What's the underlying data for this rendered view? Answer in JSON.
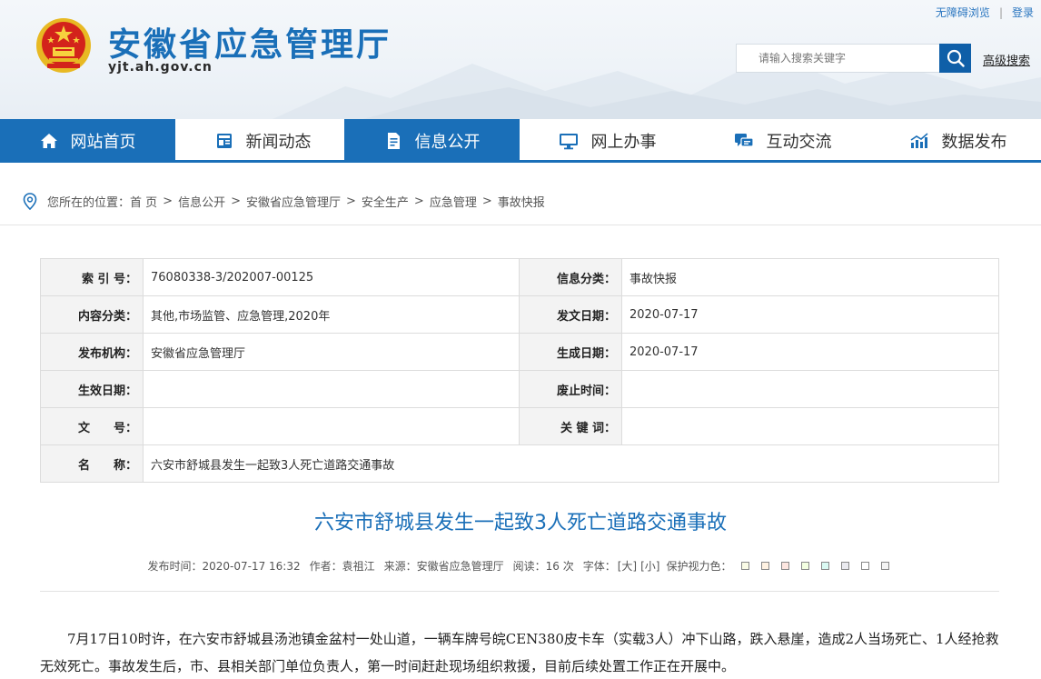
{
  "header": {
    "site_title": "安徽省应急管理厅",
    "domain": "yjt.ah.gov.cn",
    "top_links": {
      "accessibility": "无障碍浏览",
      "login": "登录"
    },
    "search": {
      "placeholder": "请输入搜索关键字",
      "advanced": "高级搜索"
    }
  },
  "nav": {
    "items": [
      {
        "label": "网站首页",
        "icon": "home-icon",
        "active": true
      },
      {
        "label": "新闻动态",
        "icon": "news-icon",
        "active": false
      },
      {
        "label": "信息公开",
        "icon": "document-icon",
        "active": true
      },
      {
        "label": "网上办事",
        "icon": "monitor-icon",
        "active": false
      },
      {
        "label": "互动交流",
        "icon": "chat-icon",
        "active": false
      },
      {
        "label": "数据发布",
        "icon": "chart-icon",
        "active": false
      }
    ]
  },
  "breadcrumb": {
    "prefix": "您所在的位置：",
    "items": [
      "首 页",
      "信息公开",
      "安徽省应急管理厅",
      "安全生产",
      "应急管理",
      "事故快报"
    ],
    "separator": ">"
  },
  "meta": {
    "index_label": "索 引 号：",
    "index_value": "76080338-3/202007-00125",
    "category_label": "信息分类：",
    "category_value": "事故快报",
    "content_label": "内容分类：",
    "content_value": "其他,市场监管、应急管理,2020年",
    "issue_date_label": "发文日期：",
    "issue_date_value": "2020-07-17",
    "org_label": "发布机构：",
    "org_value": "安徽省应急管理厅",
    "gen_date_label": "生成日期：",
    "gen_date_value": "2020-07-17",
    "effective_label": "生效日期：",
    "effective_value": "",
    "abolish_label": "废止时间：",
    "abolish_value": "",
    "docno_label": "文　　号：",
    "docno_value": "",
    "keywords_label": "关 键 词：",
    "keywords_value": "",
    "name_label": "名　　称：",
    "name_value": "六安市舒城县发生一起致3人死亡道路交通事故"
  },
  "article": {
    "title": "六安市舒城县发生一起致3人死亡道路交通事故",
    "publish_time": "发布时间：2020-07-17 16:32",
    "author": "作者：袁祖江",
    "source": "来源：安徽省应急管理厅",
    "views": "阅读：16 次",
    "font_label": "字体：",
    "font_large": "[大]",
    "font_small": "[小]",
    "eye_label": "保护视力色：",
    "eye_colors": [
      "#FAFBE6",
      "#FFF2E2",
      "#FDE6E0",
      "#F3FFE1",
      "#DAFAF3",
      "#EAEAEF",
      "#FFFFFF",
      "#F5F5F5"
    ],
    "body": "7月17日10时许，在六安市舒城县汤池镇金盆村一处山道，一辆车牌号皖CEN380皮卡车（实载3人）冲下山路，跌入悬崖，造成2人当场死亡、1人经抢救无效死亡。事故发生后，市、县相关部门单位负责人，第一时间赶赴现场组织救援，目前后续处置工作正在开展中。"
  },
  "colors": {
    "brand": "#1a6fb8",
    "search_button": "#0f5fa8"
  }
}
